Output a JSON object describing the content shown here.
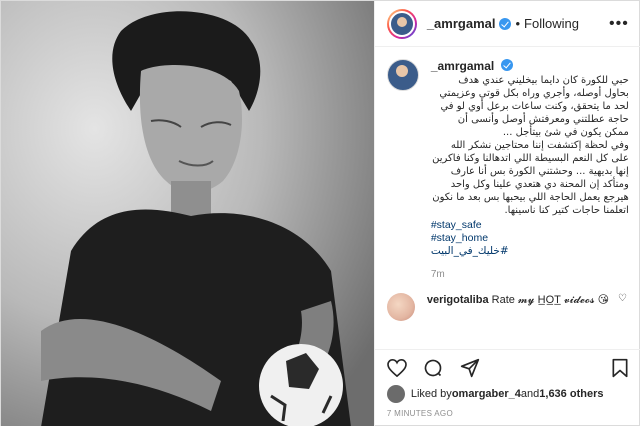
{
  "header": {
    "username": "_amrgamal",
    "separator": "•",
    "follow_status": "Following",
    "more_icon": "more-horizontal-icon"
  },
  "caption": {
    "username": "_amrgamal",
    "text": "حبي للكورة كان دايما بيخليني عندي هدف بحاول أوصله، وأجري وراه بكل قوتي وعزيمتي لحد ما يتحقق، وكنت ساعات برعل أوي لو في حاجة عطلتني ومعرفتش أوصل وأنسى أن ممكن يكون في شئ بيتأجل ...\nوفي لحظة إكتشفت إننا محتاجين نشكر الله على كل النعم البسيطة اللي اتدهالنا وكنا فاكرين إنها بديهية ... وحشتني الكورة بس أنا عارف ومتأكد إن المحنة دي هتعدي علينا وكل واحد هيرجع يعمل الحاجة اللي بيحبها بس بعد ما نكون اتعلمنا حاجات كتير كنا ناسينها.",
    "tags": [
      "#stay_safe",
      "#stay_home",
      "#خليك_في_البيت"
    ],
    "time": "7m"
  },
  "comment": {
    "username": "verigotaliba",
    "text": "Rate 𝓶𝔂 H̲O̲T̲ 𝓿𝓲𝓭𝓮𝓸𝓼 😘"
  },
  "likes": {
    "prefix": "Liked by ",
    "user": "omargaber_4",
    "middle": " and ",
    "others": "1,636 others"
  },
  "timestamp": "7 MINUTES AGO"
}
